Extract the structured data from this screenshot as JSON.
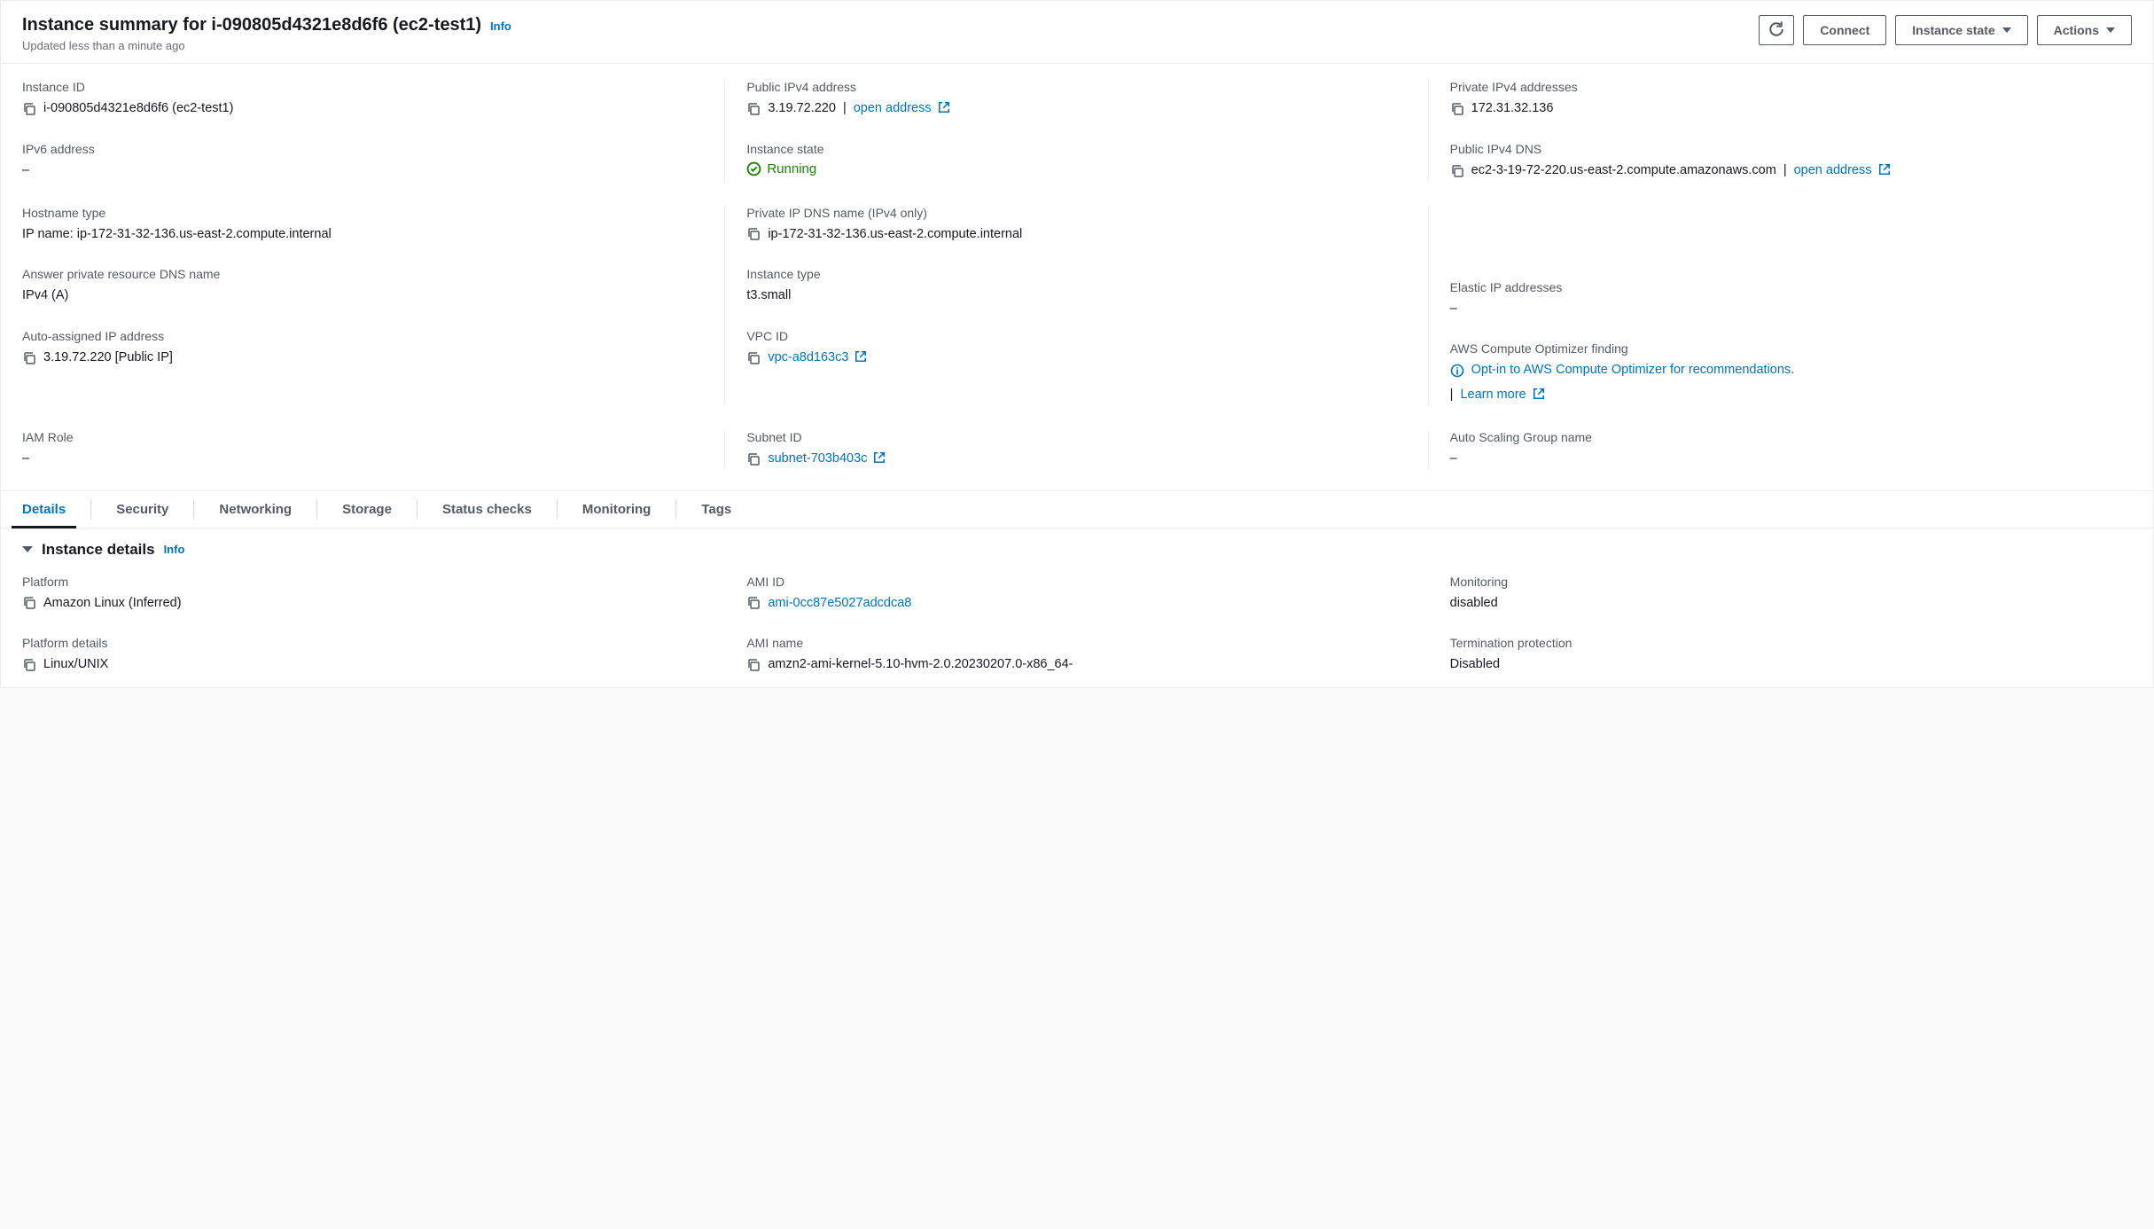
{
  "header": {
    "title": "Instance summary for i-090805d4321e8d6f6 (ec2-test1)",
    "info": "Info",
    "subtitle": "Updated less than a minute ago",
    "connect": "Connect",
    "instance_state": "Instance state",
    "actions": "Actions"
  },
  "summary": {
    "instance_id": {
      "label": "Instance ID",
      "value": "i-090805d4321e8d6f6 (ec2-test1)"
    },
    "public_ipv4": {
      "label": "Public IPv4 address",
      "value": "3.19.72.220",
      "open": "open address"
    },
    "private_ipv4": {
      "label": "Private IPv4 addresses",
      "value": "172.31.32.136"
    },
    "ipv6": {
      "label": "IPv6 address",
      "value": "–"
    },
    "instance_state": {
      "label": "Instance state",
      "value": "Running"
    },
    "public_dns": {
      "label": "Public IPv4 DNS",
      "value": "ec2-3-19-72-220.us-east-2.compute.amazonaws.com",
      "open": "open address"
    },
    "hostname_type": {
      "label": "Hostname type",
      "value": "IP name: ip-172-31-32-136.us-east-2.compute.internal"
    },
    "private_dns": {
      "label": "Private IP DNS name (IPv4 only)",
      "value": "ip-172-31-32-136.us-east-2.compute.internal"
    },
    "answer_dns": {
      "label": "Answer private resource DNS name",
      "value": "IPv4 (A)"
    },
    "instance_type": {
      "label": "Instance type",
      "value": "t3.small"
    },
    "elastic_ip": {
      "label": "Elastic IP addresses",
      "value": "–"
    },
    "auto_ip": {
      "label": "Auto-assigned IP address",
      "value": "3.19.72.220 [Public IP]"
    },
    "vpc_id": {
      "label": "VPC ID",
      "value": "vpc-a8d163c3"
    },
    "optimizer": {
      "label": "AWS Compute Optimizer finding",
      "value": "Opt-in to AWS Compute Optimizer for recommendations.",
      "learn": "Learn more"
    },
    "iam_role": {
      "label": "IAM Role",
      "value": "–"
    },
    "subnet_id": {
      "label": "Subnet ID",
      "value": "subnet-703b403c"
    },
    "asg": {
      "label": "Auto Scaling Group name",
      "value": "–"
    }
  },
  "tabs": [
    "Details",
    "Security",
    "Networking",
    "Storage",
    "Status checks",
    "Monitoring",
    "Tags"
  ],
  "section": {
    "title": "Instance details",
    "info": "Info"
  },
  "details": {
    "platform": {
      "label": "Platform",
      "value": "Amazon Linux (Inferred)"
    },
    "ami_id": {
      "label": "AMI ID",
      "value": "ami-0cc87e5027adcdca8"
    },
    "monitoring": {
      "label": "Monitoring",
      "value": "disabled"
    },
    "platform_details": {
      "label": "Platform details",
      "value": "Linux/UNIX"
    },
    "ami_name": {
      "label": "AMI name",
      "value": "amzn2-ami-kernel-5.10-hvm-2.0.20230207.0-x86_64-"
    },
    "termination": {
      "label": "Termination protection",
      "value": "Disabled"
    }
  }
}
